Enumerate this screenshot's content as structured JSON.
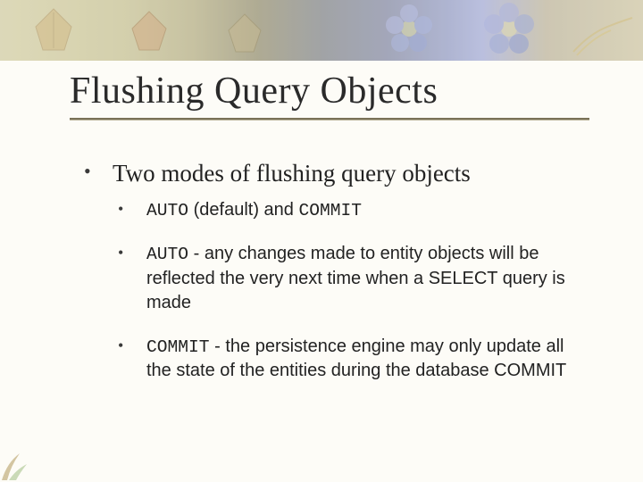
{
  "title": "Flushing Query Objects",
  "bullets": {
    "intro": "Two modes of flushing query objects",
    "sub_intro": {
      "code1": "AUTO",
      "mid": " (default) and ",
      "code2": "COMMIT"
    },
    "auto": {
      "code": "AUTO",
      "text": " - any changes made to entity objects will be reflected the very next time when a SELECT query is made"
    },
    "commit": {
      "code": "COMMIT",
      "text": " - the persistence engine may only update all the state of the entities during the database COMMIT"
    }
  }
}
